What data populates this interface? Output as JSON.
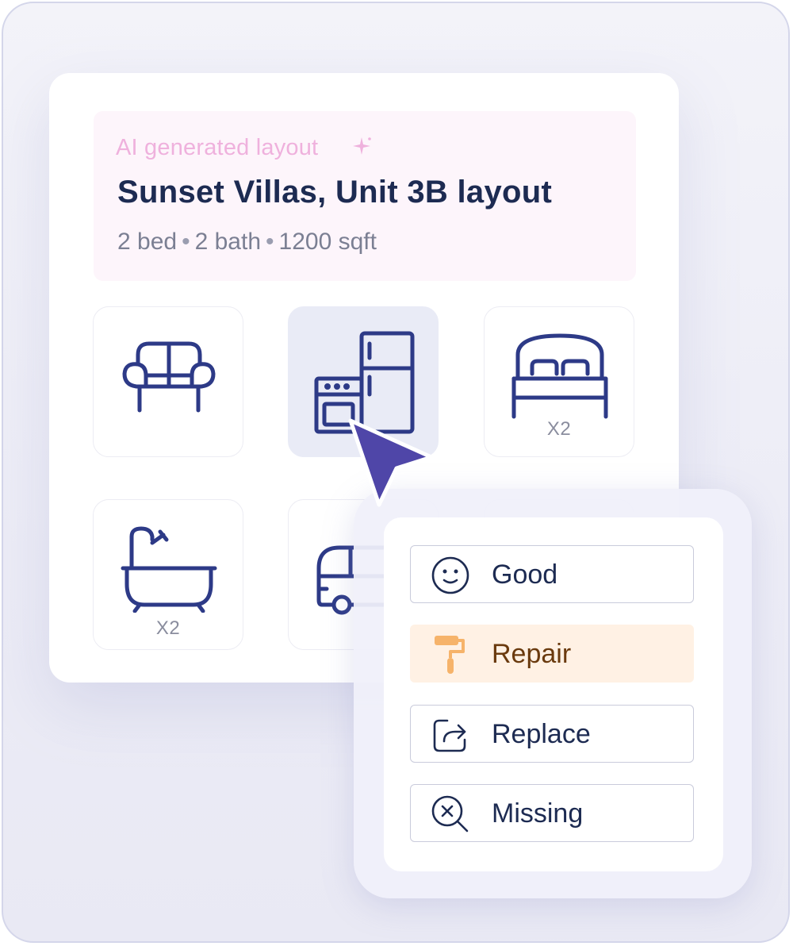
{
  "header": {
    "ai_label": "AI generated layout",
    "title": "Sunset Villas, Unit 3B layout",
    "beds": "2 bed",
    "baths": "2 bath",
    "area": "1200 sqft",
    "separator": "•"
  },
  "tiles": [
    {
      "name": "sofa",
      "icon": "sofa-icon",
      "count": ""
    },
    {
      "name": "appliances",
      "icon": "appliances-icon",
      "count": "",
      "selected": true
    },
    {
      "name": "bed",
      "icon": "bed-icon",
      "count": "X2"
    },
    {
      "name": "bathtub",
      "icon": "bathtub-icon",
      "count": "X2"
    },
    {
      "name": "vehicle",
      "icon": "van-icon",
      "count": ""
    },
    {
      "name": "hidden",
      "icon": "",
      "count": ""
    }
  ],
  "condition_menu": {
    "options": [
      {
        "label": "Good",
        "icon": "smile-icon"
      },
      {
        "label": "Repair",
        "icon": "paint-roller-icon",
        "active": true
      },
      {
        "label": "Replace",
        "icon": "replace-arrow-icon"
      },
      {
        "label": "Missing",
        "icon": "missing-search-icon"
      }
    ]
  },
  "colors": {
    "icon_stroke": "#2d3a87",
    "ai_label": "#efb1dd",
    "cursor": "#4f46a8",
    "repair_bg": "#fff1e4",
    "repair_icon": "#f6b36a"
  }
}
